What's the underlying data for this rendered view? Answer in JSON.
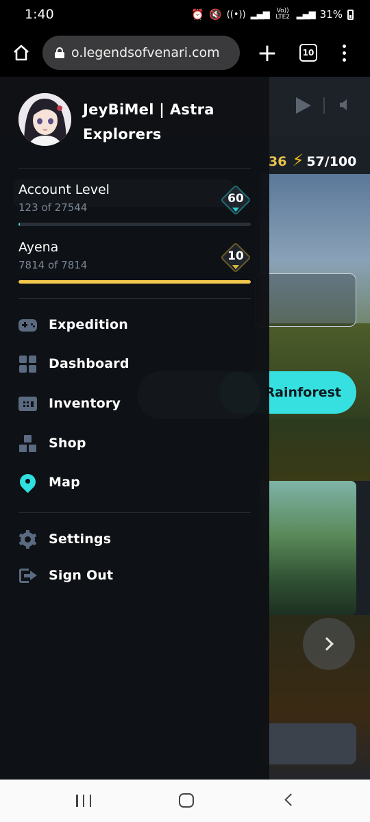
{
  "status_bar": {
    "time": "1:40",
    "network_label": "Vo)) LTE2",
    "battery": "31%"
  },
  "browser": {
    "url": "o.legendsofvenari.com",
    "tab_count": "10"
  },
  "page": {
    "points_partial": "36",
    "energy": "57/100",
    "rainforest_button": "Rainforest"
  },
  "drawer": {
    "username": "JeyBiMel | Astra Explorers",
    "account_level": {
      "title": "Account Level",
      "progress_text": "123 of 27544",
      "level": "60",
      "progress_fraction": 0.0045
    },
    "ayena": {
      "title": "Ayena",
      "progress_text": "7814 of 7814",
      "level": "10",
      "progress_fraction": 1.0
    },
    "nav": [
      {
        "label": "Expedition",
        "icon": "gamepad-icon"
      },
      {
        "label": "Dashboard",
        "icon": "grid-icon"
      },
      {
        "label": "Inventory",
        "icon": "inventory-icon"
      },
      {
        "label": "Shop",
        "icon": "shop-icon"
      },
      {
        "label": "Map",
        "icon": "map-pin-icon"
      }
    ],
    "footer_nav": [
      {
        "label": "Settings",
        "icon": "gear-icon"
      },
      {
        "label": "Sign Out",
        "icon": "sign-out-icon"
      }
    ]
  },
  "colors": {
    "accent_cyan": "#2fe0e0",
    "ayena_bar": "#f2c94c",
    "drawer_bg": "#0e1115"
  }
}
